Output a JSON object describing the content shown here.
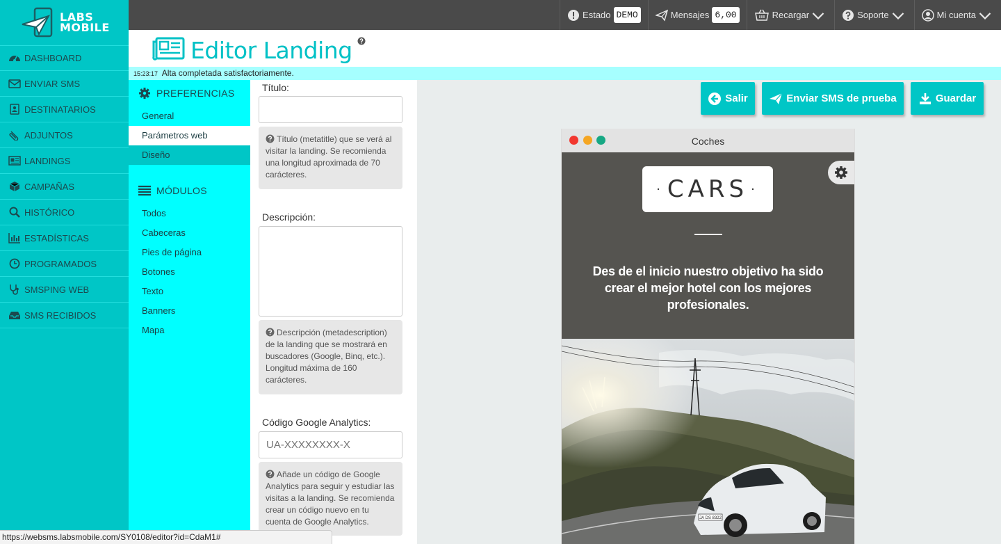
{
  "brand": {
    "line1": "LABS",
    "line2": "MOBILE",
    "color": "#00c6c6"
  },
  "sidebar": {
    "items": [
      {
        "label": "DASHBOARD",
        "icon": "dashboard-icon"
      },
      {
        "label": "ENVIAR SMS",
        "icon": "envelope-icon"
      },
      {
        "label": "DESTINATARIOS",
        "icon": "contacts-icon"
      },
      {
        "label": "ADJUNTOS",
        "icon": "paperclip-icon"
      },
      {
        "label": "LANDINGS",
        "icon": "newspaper-icon"
      },
      {
        "label": "CAMPAÑAS",
        "icon": "cube-icon"
      },
      {
        "label": "HISTÓRICO",
        "icon": "search-icon"
      },
      {
        "label": "ESTADÍSTICAS",
        "icon": "bar-chart-icon"
      },
      {
        "label": "PROGRAMADOS",
        "icon": "clock-icon"
      },
      {
        "label": "SMSPING WEB",
        "icon": "stethoscope-icon"
      },
      {
        "label": "SMS RECIBIDOS",
        "icon": "inbox-icon"
      }
    ]
  },
  "topbar": {
    "estado_label": "Estado",
    "estado_value": "DEMO",
    "mensajes_label": "Mensajes",
    "mensajes_value": "6,00",
    "recargar_label": "Recargar",
    "soporte_label": "Soporte",
    "cuenta_label": "Mi cuenta"
  },
  "page": {
    "title": "Editor Landing",
    "notice_time": "15:23:17",
    "notice_text": "Alta completada satisfactoriamente."
  },
  "prefs": {
    "preferences_heading": "PREFERENCIAS",
    "preferences_items": [
      "General",
      "Parámetros web",
      "Diseño"
    ],
    "modules_heading": "MÓDULOS",
    "modules_items": [
      "Todos",
      "Cabeceras",
      "Pies de página",
      "Botones",
      "Texto",
      "Banners",
      "Mapa"
    ]
  },
  "form": {
    "title_label": "Título:",
    "title_value": "",
    "title_help": "Título (metatitle) que se verá al visitar la landing. Se recomienda una longitud aproximada de 70 carácteres.",
    "desc_label": "Descripción:",
    "desc_value": "",
    "desc_help": "Descripción (metadescription) de la landing que se mostrará en buscadores (Google, Binq, etc.). Longitud máxima de 160 carácteres.",
    "ga_label": "Código Google Analytics:",
    "ga_placeholder": "UA-XXXXXXXX-X",
    "ga_help": "Añade un código de Google Analytics para seguir y estudiar las visitas a la landing. Se recomienda crear un código nuevo en tu cuenta de Google Analytics."
  },
  "actions": {
    "exit_label": "Salir",
    "test_label": "Enviar SMS de prueba",
    "save_label": "Guardar"
  },
  "preview": {
    "window_title": "Coches",
    "logo_text": "CARS",
    "logo_bullet": "·",
    "headline": "Des de el inicio nuestro objetivo ha sido crear el mejor hotel con los mejores profesionales.",
    "plate": "JA DS 8322"
  },
  "statusbar": {
    "url": "https://websms.labsmobile.com/SY0108/editor?id=CdaM1#"
  }
}
